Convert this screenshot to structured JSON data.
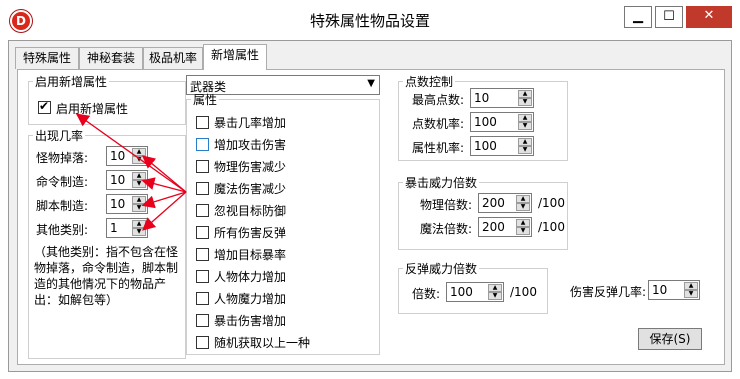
{
  "window": {
    "title": "特殊属性物品设置",
    "icon_letter": "D",
    "min_glyph": "▁",
    "max_glyph": "☐",
    "close_glyph": "✕"
  },
  "tabs": [
    {
      "label": "特殊属性"
    },
    {
      "label": "神秘套装"
    },
    {
      "label": "极品机率"
    },
    {
      "label": "新增属性"
    }
  ],
  "enable_group": {
    "legend": "启用新增属性",
    "checkbox_label": "启用新增属性",
    "checked": true
  },
  "chance_group": {
    "legend": "出现几率",
    "rows": [
      {
        "label": "怪物掉落:",
        "value": "10"
      },
      {
        "label": "命令制造:",
        "value": "10"
      },
      {
        "label": "脚本制造:",
        "value": "10"
      },
      {
        "label": "其他类别:",
        "value": "1"
      }
    ],
    "note": "（其他类别：指不包含在怪物掉落，命令制造，脚本制造的其他情况下的物品产出：如解包等）"
  },
  "weapon_combo": {
    "value": "武器类"
  },
  "attr_group": {
    "legend": "属性",
    "items": [
      {
        "label": "暴击几率增加",
        "checked": false
      },
      {
        "label": "增加攻击伤害",
        "checked": false,
        "focus": true
      },
      {
        "label": "物理伤害减少",
        "checked": false
      },
      {
        "label": "魔法伤害减少",
        "checked": false
      },
      {
        "label": "忽视目标防御",
        "checked": false
      },
      {
        "label": "所有伤害反弹",
        "checked": false
      },
      {
        "label": "增加目标暴率",
        "checked": false
      },
      {
        "label": "人物体力增加",
        "checked": false
      },
      {
        "label": "人物魔力增加",
        "checked": false
      },
      {
        "label": "暴击伤害增加",
        "checked": false
      },
      {
        "label": "随机获取以上一种",
        "checked": false
      }
    ]
  },
  "points_group": {
    "legend": "点数控制",
    "rows": [
      {
        "label": "最高点数:",
        "value": "10"
      },
      {
        "label": "点数机率:",
        "value": "100"
      },
      {
        "label": "属性机率:",
        "value": "100"
      }
    ]
  },
  "crit_group": {
    "legend": "暴击威力倍数",
    "rows": [
      {
        "label": "物理倍数:",
        "value": "200",
        "suffix": "/100"
      },
      {
        "label": "魔法倍数:",
        "value": "200",
        "suffix": "/100"
      }
    ]
  },
  "reflect_group": {
    "legend": "反弹威力倍数",
    "row": {
      "label": "倍数:",
      "value": "100",
      "suffix": "/100"
    }
  },
  "reflect_chance": {
    "label": "伤害反弹几率:",
    "value": "10"
  },
  "save_button": {
    "label": "保存(S)"
  },
  "colors": {
    "annotation_arrow": "#e8001c",
    "close_button": "#c0392b"
  }
}
